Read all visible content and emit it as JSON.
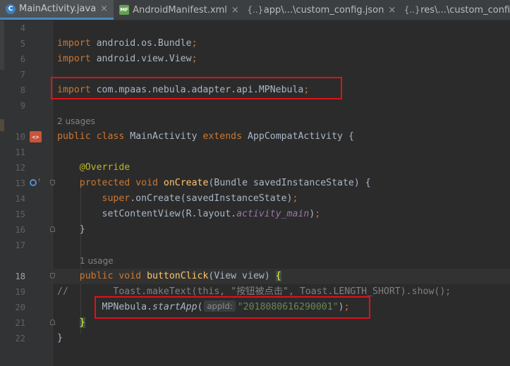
{
  "tabs": [
    {
      "label": "MainActivity.java",
      "icon": "java-class-icon",
      "close": "×",
      "active": true
    },
    {
      "label": "AndroidManifest.xml",
      "icon": "xml-manifest-icon",
      "close": "×",
      "active": false
    },
    {
      "label": "app\\...\\custom_config.json",
      "icon": "json-file-icon",
      "close": "×",
      "active": false
    },
    {
      "label": "res\\...\\custom_config.json",
      "icon": "json-file-icon",
      "close": "",
      "active": false
    }
  ],
  "editor": {
    "lines": {
      "l4": "4",
      "l5": "5",
      "l6": "6",
      "l7": "7",
      "l8": "8",
      "l9": "9",
      "l10": "10",
      "l11": "11",
      "l12": "12",
      "l13": "13",
      "l14": "14",
      "l15": "15",
      "l16": "16",
      "l17": "17",
      "l18": "18",
      "l19": "19",
      "l20": "20",
      "l21": "21",
      "l22": "22"
    },
    "usages_class": "2 usages",
    "usages_method": "1 usage",
    "code": {
      "import_kw": "import",
      "import1": " android.os.Bundle",
      "import2": " android.view.View",
      "import3": " com.mpaas.nebula.adapter.api.MPNebula",
      "semi": ";",
      "public": "public",
      "class": "class",
      "classname": "MainActivity",
      "extends": "extends",
      "superclass": "AppCompatActivity",
      "open_brace": "{",
      "close_brace": "}",
      "override": "@Override",
      "protected": "protected",
      "void": "void",
      "oncreate": "onCreate",
      "oncreate_params": "(Bundle savedInstanceState) ",
      "super": "super",
      "super_call": ".onCreate(savedInstanceState)",
      "set_content": "setContentView(R.layout.",
      "activity_main": "activity_main",
      "paren_close": ")",
      "button_click": "buttonClick",
      "button_params": "(View view) ",
      "comment_slash": "//",
      "comment_body": "        Toast.makeText(this, \"按钮被点击\", Toast.LENGTH_SHORT).show();",
      "mpnebula": "MPNebula.",
      "start_app": "startApp",
      "paren_open": "(",
      "hint": "appId:",
      "app_id": "\"2018080616290001\""
    }
  },
  "colors": {
    "background": "#2b2b2b",
    "keyword": "#cc7832",
    "method": "#ffc66d",
    "string": "#6a8759",
    "annotation": "#bbb529",
    "highlight_box": "#e0101a"
  }
}
